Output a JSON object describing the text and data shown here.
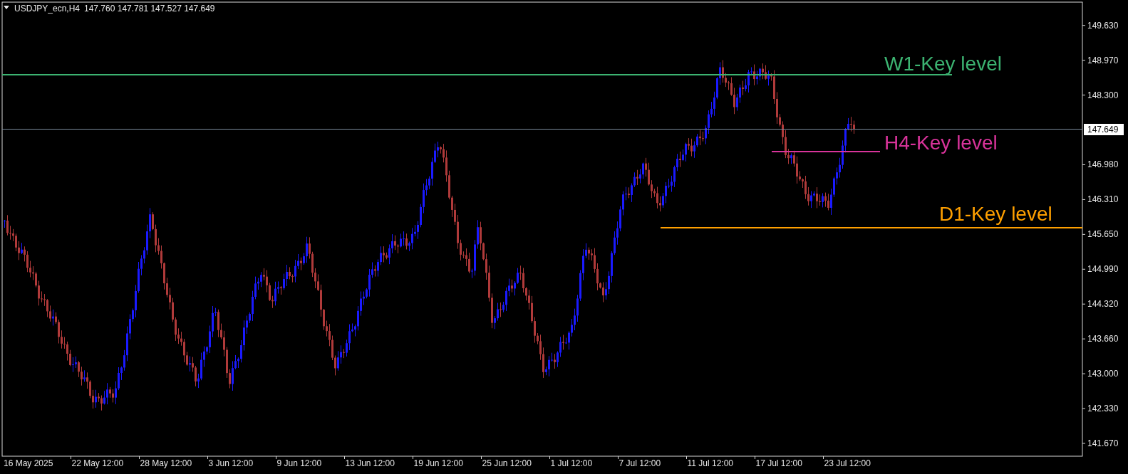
{
  "header": {
    "symbol": "USDJPY_ecn,H4",
    "ohlc": "147.760 147.781 147.527 147.649"
  },
  "price_axis": [
    "149.630",
    "148.970",
    "148.300",
    "146.980",
    "146.310",
    "145.650",
    "144.990",
    "144.320",
    "143.660",
    "143.000",
    "142.330",
    "141.670"
  ],
  "current_price": "147.649",
  "time_axis": [
    "16 May 2025",
    "22 May 12:00",
    "28 May 12:00",
    "3 Jun 12:00",
    "9 Jun 12:00",
    "13 Jun 12:00",
    "19 Jun 12:00",
    "25 Jun 12:00",
    "1 Jul 12:00",
    "7 Jul 12:00",
    "11 Jul 12:00",
    "17 Jul 12:00",
    "23 Jul 12:00"
  ],
  "key_levels": [
    {
      "label": "W1-Key level",
      "color": "#3cb371"
    },
    {
      "label": "H4-Key level",
      "color": "#d8339a"
    },
    {
      "label": "D1-Key level",
      "color": "#ffa000"
    }
  ]
}
